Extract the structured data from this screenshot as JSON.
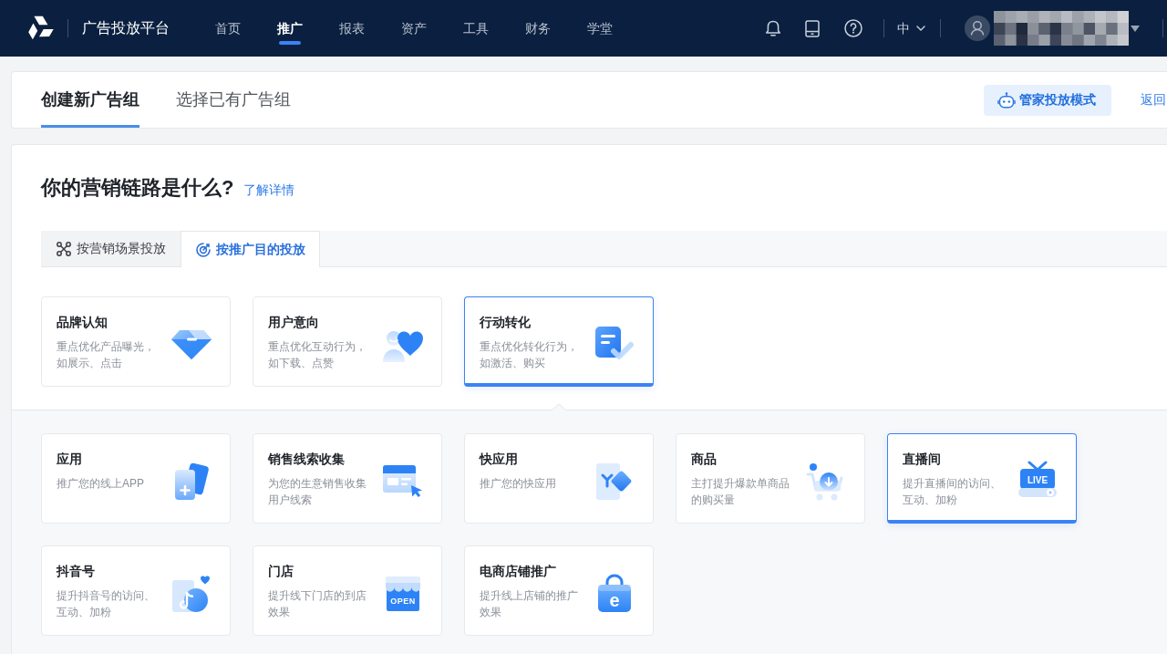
{
  "top_nav": {
    "title": "广告投放平台",
    "items": [
      {
        "label": "首页",
        "selected": false
      },
      {
        "label": "推广",
        "selected": true
      },
      {
        "label": "报表",
        "selected": false
      },
      {
        "label": "资产",
        "selected": false
      },
      {
        "label": "工具",
        "selected": false
      },
      {
        "label": "财务",
        "selected": false
      },
      {
        "label": "学堂",
        "selected": false
      }
    ],
    "language": "中"
  },
  "group_tabs": [
    {
      "label": "创建新广告组",
      "selected": true
    },
    {
      "label": "选择已有广告组",
      "selected": false
    }
  ],
  "header_actions": {
    "mode_button": "管家投放模式",
    "back_link": "返回"
  },
  "question": {
    "title": "你的营销链路是什么?",
    "link": "了解详情"
  },
  "mode_tabs": [
    {
      "label": "按营销场景投放",
      "selected": false
    },
    {
      "label": "按推广目的投放",
      "selected": true
    }
  ],
  "objectives": [
    {
      "title": "品牌认知",
      "description": "重点优化产品曝光，如展示、点击",
      "selected": false
    },
    {
      "title": "用户意向",
      "description": "重点优化互动行为，如下载、点赞",
      "selected": false
    },
    {
      "title": "行动转化",
      "description": "重点优化转化行为，如激活、购买",
      "selected": true
    }
  ],
  "goals": [
    {
      "title": "应用",
      "description": "推广您的线上APP",
      "selected": false
    },
    {
      "title": "销售线索收集",
      "description": "为您的生意销售收集用户线索",
      "selected": false
    },
    {
      "title": "快应用",
      "description": "推广您的快应用",
      "selected": false
    },
    {
      "title": "商品",
      "description": "主打提升爆款单商品的购买量",
      "selected": false
    },
    {
      "title": "直播间",
      "description": "提升直播间的访问、互动、加粉",
      "icon_text": "LIVE",
      "selected": true
    },
    {
      "title": "抖音号",
      "description": "提升抖音号的访问、互动、加粉",
      "selected": false
    },
    {
      "title": "门店",
      "description": "提升线下门店的到店效果",
      "icon_text": "OPEN",
      "selected": false
    },
    {
      "title": "电商店铺推广",
      "description": "提升线上店铺的推广效果",
      "icon_text": "e",
      "selected": false
    }
  ]
}
